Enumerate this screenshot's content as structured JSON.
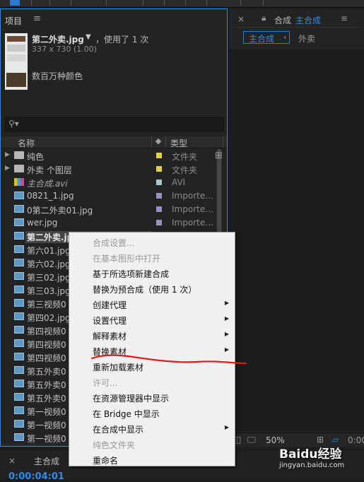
{
  "project_panel": {
    "tab_label": "项目",
    "menu_icon": "≡",
    "asset": {
      "name": "第二外卖.jpg",
      "usage": "，使用了 1 次",
      "dimensions": "337 x 730 (1.00)",
      "colors": "数百万种颜色"
    },
    "search_placeholder": "",
    "columns": {
      "name": "名称",
      "type": "类型"
    },
    "items": [
      {
        "label": "纯色",
        "type": "文件夹",
        "kind": "folder",
        "swatch": "#e3cf4a"
      },
      {
        "label": "外卖 个图层",
        "type": "文件夹",
        "kind": "folder",
        "swatch": "#e3cf4a"
      },
      {
        "label": "主合成.avi",
        "type": "AVI",
        "kind": "avi",
        "swatch": "#a9c4c4"
      },
      {
        "label": "0821_1.jpg",
        "type": "Importe…G",
        "kind": "img",
        "swatch": "#9b8fc4"
      },
      {
        "label": "0第二外卖01.jpg",
        "type": "Importe…G",
        "kind": "img",
        "swatch": "#9b8fc4"
      },
      {
        "label": "wer.jpg",
        "type": "Importe…G",
        "kind": "img",
        "swatch": "#9b8fc4"
      },
      {
        "label": "第二外卖.jpg",
        "type": "Importe…G",
        "kind": "img",
        "swatch": "#9b8fc4"
      },
      {
        "label": "第六01.jpg",
        "type": "",
        "kind": "img",
        "swatch": ""
      },
      {
        "label": "第六02.jpg",
        "type": "",
        "kind": "img",
        "swatch": ""
      },
      {
        "label": "第三02.jpg",
        "type": "",
        "kind": "img",
        "swatch": ""
      },
      {
        "label": "第三03.jpg",
        "type": "",
        "kind": "img",
        "swatch": ""
      },
      {
        "label": "第三视频0",
        "type": "",
        "kind": "img",
        "swatch": ""
      },
      {
        "label": "第四02.jpg",
        "type": "",
        "kind": "img",
        "swatch": ""
      },
      {
        "label": "第四视频0",
        "type": "",
        "kind": "img",
        "swatch": ""
      },
      {
        "label": "第四视频0",
        "type": "",
        "kind": "img",
        "swatch": ""
      },
      {
        "label": "第四视频0",
        "type": "",
        "kind": "img",
        "swatch": ""
      },
      {
        "label": "第五外卖0",
        "type": "",
        "kind": "img",
        "swatch": ""
      },
      {
        "label": "第五外卖0",
        "type": "",
        "kind": "img",
        "swatch": ""
      },
      {
        "label": "第五外卖0",
        "type": "",
        "kind": "img",
        "swatch": ""
      },
      {
        "label": "第一视频0",
        "type": "",
        "kind": "img",
        "swatch": ""
      },
      {
        "label": "第一视频0",
        "type": "",
        "kind": "img",
        "swatch": ""
      },
      {
        "label": "第一视频0",
        "type": "",
        "kind": "img",
        "swatch": ""
      }
    ]
  },
  "composition_panel": {
    "label": "合成",
    "name": "主合成",
    "breadcrumb": [
      "主合成",
      "外卖"
    ],
    "zoom": "50%",
    "time": "0:00"
  },
  "timeline": {
    "comp_name": "主合成",
    "timecode": "0:00:04:01"
  },
  "context_menu": {
    "items": [
      {
        "label": "合成设置...",
        "disabled": true,
        "submenu": false
      },
      {
        "label": "在基本图形中打开",
        "disabled": true,
        "submenu": false
      },
      {
        "label": "基于所选项新建合成",
        "disabled": false,
        "submenu": false
      },
      {
        "label": "替换为预合成（使用 1 次）",
        "disabled": false,
        "submenu": false
      },
      {
        "label": "创建代理",
        "disabled": false,
        "submenu": true
      },
      {
        "label": "设置代理",
        "disabled": false,
        "submenu": true
      },
      {
        "label": "解释素材",
        "disabled": false,
        "submenu": true
      },
      {
        "label": "替换素材",
        "disabled": false,
        "submenu": true
      },
      {
        "label": "重新加载素材",
        "disabled": false,
        "submenu": false
      },
      {
        "label": "许可...",
        "disabled": true,
        "submenu": false
      },
      {
        "label": "在资源管理器中显示",
        "disabled": false,
        "submenu": false
      },
      {
        "label": "在 Bridge 中显示",
        "disabled": false,
        "submenu": false
      },
      {
        "label": "在合成中显示",
        "disabled": false,
        "submenu": true
      },
      {
        "label": "纯色文件夹",
        "disabled": true,
        "submenu": false
      },
      {
        "label": "重命名",
        "disabled": false,
        "submenu": false
      }
    ]
  },
  "watermark": {
    "brand": "Baidu经验",
    "url": "jingyan.baidu.com"
  },
  "colors": {
    "accent": "#2d8ceb",
    "annotation": "#e01818"
  }
}
